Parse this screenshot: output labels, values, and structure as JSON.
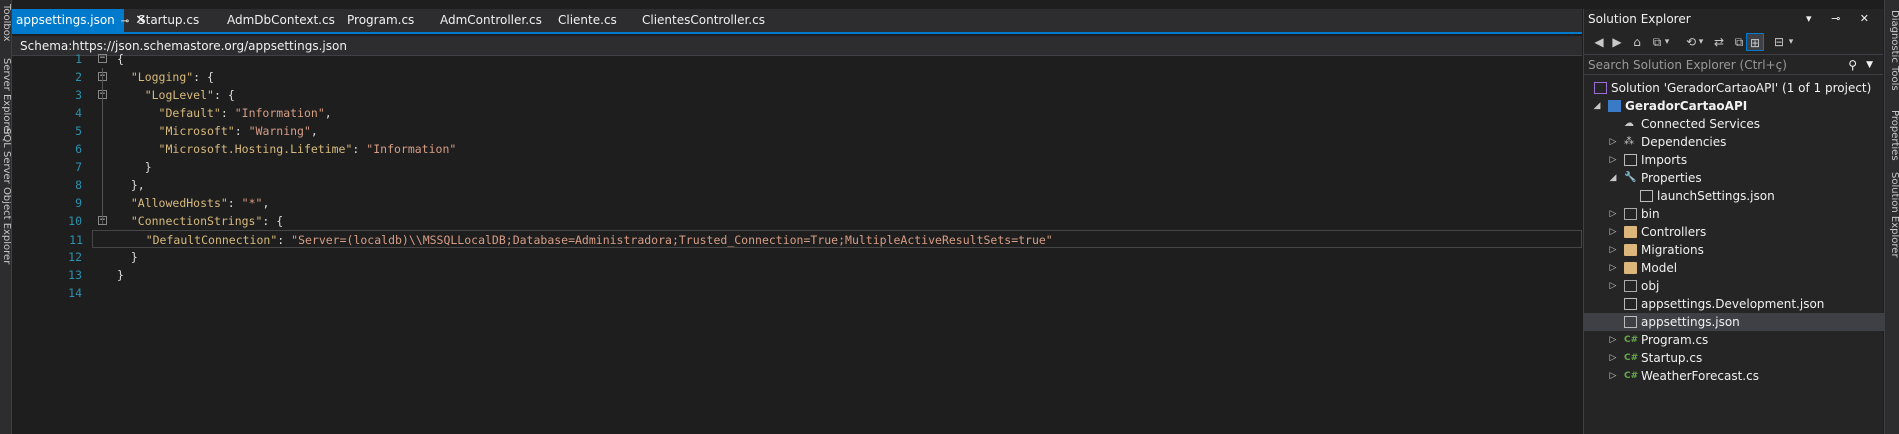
{
  "left_strip": {
    "tabs": [
      "Toolbox",
      "Server Explorer",
      "SQL Server Object Explorer"
    ]
  },
  "tabs": [
    {
      "label": "appsettings.json",
      "active": true,
      "pinned": true
    },
    {
      "label": "Startup.cs"
    },
    {
      "label": "AdmDbContext.cs"
    },
    {
      "label": "Program.cs"
    },
    {
      "label": "AdmController.cs"
    },
    {
      "label": "Cliente.cs"
    },
    {
      "label": "ClientesController.cs"
    }
  ],
  "tab_pin_icon": "⊸",
  "tab_close_icon": "✕",
  "schema": {
    "label": "Schema:",
    "value": "https://json.schemastore.org/appsettings.json"
  },
  "code_lines": [
    {
      "num": "1",
      "fold": "⊟",
      "text": "{"
    },
    {
      "num": "2",
      "fold": "⊟",
      "text": "  \"Logging\": {"
    },
    {
      "num": "3",
      "fold": "⊟",
      "text": "    \"LogLevel\": {"
    },
    {
      "num": "4",
      "text": "      \"Default\": \"Information\","
    },
    {
      "num": "5",
      "text": "      \"Microsoft\": \"Warning\","
    },
    {
      "num": "6",
      "text": "      \"Microsoft.Hosting.Lifetime\": \"Information\""
    },
    {
      "num": "7",
      "text": "    }"
    },
    {
      "num": "8",
      "text": "  },"
    },
    {
      "num": "9",
      "text": "  \"AllowedHosts\": \"*\","
    },
    {
      "num": "10",
      "fold": "⊟",
      "text": "  \"ConnectionStrings\": {"
    },
    {
      "num": "11",
      "text": "    \"DefaultConnection\": \"Server=(localdb)\\\\MSSQLLocalDB;Database=Administradora;Trusted_Connection=True;MultipleActiveResultSets=true\""
    },
    {
      "num": "12",
      "text": "  }"
    },
    {
      "num": "13",
      "text": "}"
    },
    {
      "num": "14",
      "text": ""
    }
  ],
  "solution_explorer": {
    "title": "Solution Explorer",
    "title_icons": "▾ ⊸ ✕",
    "search_placeholder": "Search Solution Explorer (Ctrl+ç)",
    "search_icon": "⚲",
    "toolbar_icons": [
      "◀",
      "▶",
      "⌂",
      "⧉",
      "▾",
      "⟲",
      "▾",
      "⇄",
      "⧉",
      "⊞",
      "⊟",
      "▾"
    ],
    "nodes": [
      {
        "label": "Solution 'GeradorCartaoAPI' (1 of 1 project)",
        "level": 0,
        "icon": "sol"
      },
      {
        "label": "GeradorCartaoAPI",
        "level": 0,
        "icon": "proj",
        "arrow": "◢",
        "bold": true
      },
      {
        "label": "Connected Services",
        "level": 1,
        "icon": "cloud"
      },
      {
        "label": "Dependencies",
        "level": 1,
        "icon": "deps",
        "arrow": "▷"
      },
      {
        "label": "Imports",
        "level": 1,
        "icon": "file",
        "arrow": "▷"
      },
      {
        "label": "Properties",
        "level": 1,
        "icon": "wrench",
        "arrow": "◢"
      },
      {
        "label": "launchSettings.json",
        "level": 2,
        "icon": "file"
      },
      {
        "label": "bin",
        "level": 1,
        "icon": "folder-grey",
        "arrow": "▷"
      },
      {
        "label": "Controllers",
        "level": 1,
        "icon": "folder",
        "arrow": "▷"
      },
      {
        "label": "Migrations",
        "level": 1,
        "icon": "folder",
        "arrow": "▷"
      },
      {
        "label": "Model",
        "level": 1,
        "icon": "folder",
        "arrow": "▷"
      },
      {
        "label": "obj",
        "level": 1,
        "icon": "folder-grey",
        "arrow": "▷"
      },
      {
        "label": "appsettings.Development.json",
        "level": 1,
        "icon": "file"
      },
      {
        "label": "appsettings.json",
        "level": 1,
        "icon": "file",
        "selected": true
      },
      {
        "label": "Program.cs",
        "level": 1,
        "icon": "cs",
        "arrow": "▷"
      },
      {
        "label": "Startup.cs",
        "level": 1,
        "icon": "cs",
        "arrow": "▷"
      },
      {
        "label": "WeatherForecast.cs",
        "level": 1,
        "icon": "cs",
        "arrow": "▷"
      }
    ]
  },
  "right_strip": {
    "tabs": [
      "Diagnostic Tools",
      "Properties",
      "Solution Explorer"
    ]
  }
}
